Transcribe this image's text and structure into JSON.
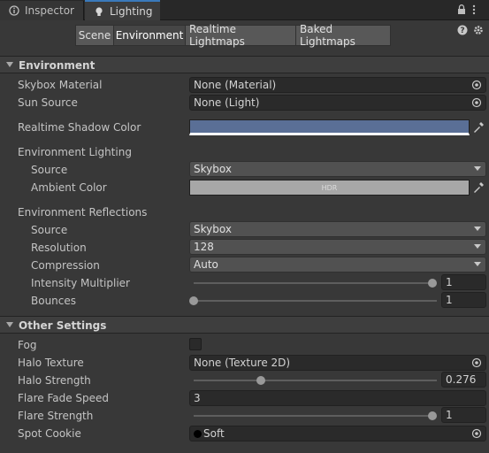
{
  "tabs": [
    {
      "label": "Inspector",
      "icon": "info-icon"
    },
    {
      "label": "Lighting",
      "icon": "lightbulb-icon"
    }
  ],
  "toolbar": [
    "Scene",
    "Environment",
    "Realtime Lightmaps",
    "Baked Lightmaps"
  ],
  "toolbar_selected": "Environment",
  "environment": {
    "title": "Environment",
    "skybox_material": {
      "label": "Skybox Material",
      "value": "None (Material)"
    },
    "sun_source": {
      "label": "Sun Source",
      "value": "None (Light)"
    },
    "realtime_shadow_color": {
      "label": "Realtime Shadow Color",
      "color": "#5a6f96"
    },
    "environment_lighting": {
      "label": "Environment Lighting",
      "source": {
        "label": "Source",
        "value": "Skybox"
      },
      "ambient_color": {
        "label": "Ambient Color",
        "value": "HDR",
        "color": "#a7a7a7"
      }
    },
    "environment_reflections": {
      "label": "Environment Reflections",
      "source": {
        "label": "Source",
        "value": "Skybox"
      },
      "resolution": {
        "label": "Resolution",
        "value": "128"
      },
      "compression": {
        "label": "Compression",
        "value": "Auto"
      },
      "intensity_multiplier": {
        "label": "Intensity Multiplier",
        "value": "1",
        "fraction": 1.0
      },
      "bounces": {
        "label": "Bounces",
        "value": "1",
        "fraction": 0.0
      }
    }
  },
  "other_settings": {
    "title": "Other Settings",
    "fog": {
      "label": "Fog",
      "checked": false
    },
    "halo_texture": {
      "label": "Halo Texture",
      "value": "None (Texture 2D)"
    },
    "halo_strength": {
      "label": "Halo Strength",
      "value": "0.276",
      "fraction": 0.276
    },
    "flare_fade_speed": {
      "label": "Flare Fade Speed",
      "value": "3"
    },
    "flare_strength": {
      "label": "Flare Strength",
      "value": "1",
      "fraction": 1.0
    },
    "spot_cookie": {
      "label": "Spot Cookie",
      "value": "Soft"
    }
  },
  "colors": {
    "accent": "#3a79bb",
    "background": "#383838"
  }
}
